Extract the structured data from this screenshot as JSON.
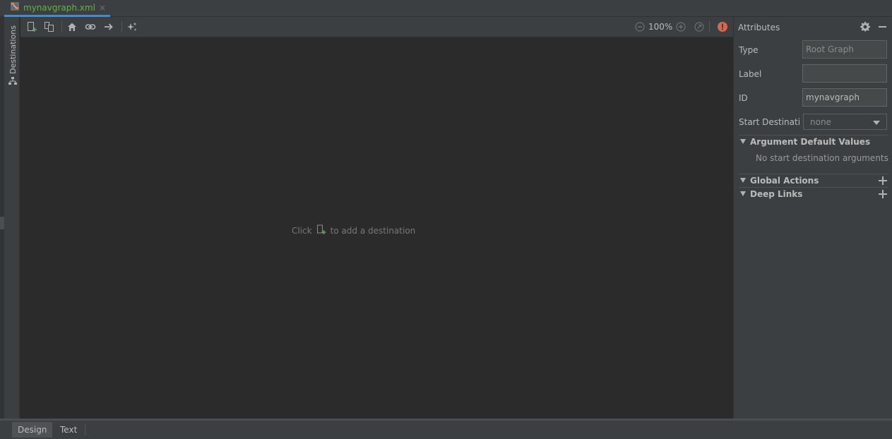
{
  "file_tab": {
    "label": "mynavgraph.xml",
    "close": "×",
    "icon": "nav-graph-file-icon"
  },
  "left_strip": {
    "destinations_label": "Destinations",
    "icon": "tree-icon"
  },
  "toolbar": {
    "icons": [
      "new-destination-icon",
      "nested-graph-icon",
      "home-icon",
      "link-icon",
      "arrow-right-icon",
      "auto-arrange-icon",
      "zoom-out-icon",
      "zoom-in-icon",
      "zoom-to-fit-icon",
      "error-icon"
    ],
    "zoom_level": "100%"
  },
  "canvas": {
    "hint_prefix": "Click",
    "hint_suffix": "to add a destination"
  },
  "attributes": {
    "title": "Attributes",
    "type_label": "Type",
    "type_value": "Root Graph",
    "label_label": "Label",
    "label_value": "",
    "id_label": "ID",
    "id_value": "mynavgraph",
    "start_label": "Start Destination",
    "start_value": "none",
    "sections": {
      "argument_defaults": "Argument Default Values",
      "argument_defaults_empty": "No start destination arguments",
      "global_actions": "Global Actions",
      "deep_links": "Deep Links"
    }
  },
  "bottom_tabs": {
    "design": "Design",
    "text": "Text"
  },
  "colors": {
    "accent_blue": "#4a88c7",
    "file_green": "#62b543",
    "error_orange": "#c75450",
    "panel": "#3c3f41",
    "canvas": "#2b2b2b"
  }
}
